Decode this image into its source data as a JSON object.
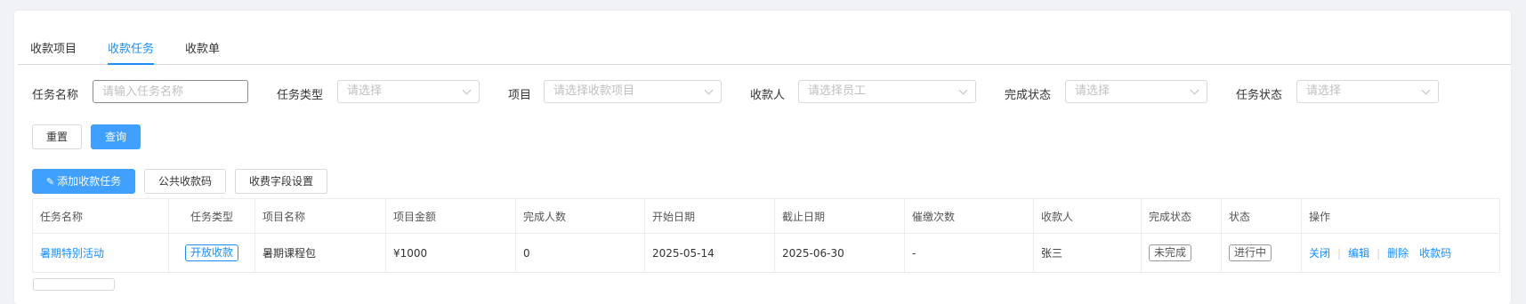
{
  "tabs": [
    {
      "label": "收款项目",
      "active": false
    },
    {
      "label": "收款任务",
      "active": true
    },
    {
      "label": "收款单",
      "active": false
    }
  ],
  "filters": {
    "task_name": {
      "label": "任务名称",
      "placeholder": "请输入任务名称"
    },
    "task_type": {
      "label": "任务类型",
      "placeholder": "请选择"
    },
    "project": {
      "label": "项目",
      "placeholder": "请选择收款项目"
    },
    "payee": {
      "label": "收款人",
      "placeholder": "请选择员工"
    },
    "completion_status": {
      "label": "完成状态",
      "placeholder": "请选择"
    },
    "task_status": {
      "label": "任务状态",
      "placeholder": "请选择"
    }
  },
  "buttons": {
    "reset": "重置",
    "query": "查询",
    "add_task": "添加收款任务",
    "public_code": "公共收款码",
    "fee_fields": "收费字段设置"
  },
  "table": {
    "columns": [
      "任务名称",
      "任务类型",
      "项目名称",
      "项目金额",
      "完成人数",
      "开始日期",
      "截止日期",
      "催缴次数",
      "收款人",
      "完成状态",
      "状态",
      "操作"
    ],
    "rows": [
      {
        "task_name": "暑期特别活动",
        "task_type": "开放收款",
        "project_name": "暑期课程包",
        "amount": "¥1000",
        "completed_count": "0",
        "start_date": "2025-05-14",
        "end_date": "2025-06-30",
        "reminder_count": "-",
        "payee": "张三",
        "completion_status": "未完成",
        "status": "进行中",
        "actions": [
          "关闭",
          "编辑",
          "删除",
          "收款码"
        ]
      }
    ]
  },
  "colors": {
    "accent": "#1890ff",
    "primary_button": "#40a0ff",
    "border": "#d9d9d9",
    "background": "#f0f2f5"
  }
}
